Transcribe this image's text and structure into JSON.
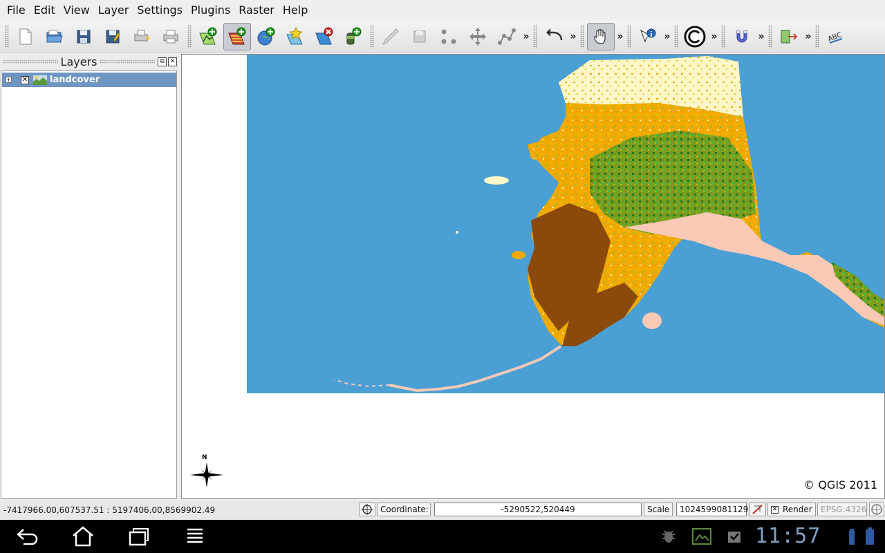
{
  "menu": [
    {
      "label": "File",
      "name": "menu-file"
    },
    {
      "label": "Edit",
      "name": "menu-edit"
    },
    {
      "label": "View",
      "name": "menu-view"
    },
    {
      "label": "Layer",
      "name": "menu-layer"
    },
    {
      "label": "Settings",
      "name": "menu-settings"
    },
    {
      "label": "Plugins",
      "name": "menu-plugins"
    },
    {
      "label": "Raster",
      "name": "menu-raster"
    },
    {
      "label": "Help",
      "name": "menu-help"
    }
  ],
  "toolbar": {
    "more_label": "»",
    "icons": [
      "new-project-icon",
      "open-project-icon",
      "save-project-icon",
      "save-as-icon",
      "print-composer-icon",
      "print-icon",
      "add-vector-layer-icon",
      "add-raster-layer-icon",
      "add-wms-layer-icon",
      "new-shapefile-icon",
      "remove-layer-icon",
      "add-postgis-icon",
      "toggle-editing-icon",
      "save-edits-icon",
      "capture-point-icon",
      "move-feature-icon",
      "node-tool-icon",
      "undo-icon",
      "pan-icon",
      "identify-icon",
      "copyright-label-icon",
      "magnet-icon",
      "georeferencer-icon",
      "label-icon"
    ]
  },
  "layers_panel": {
    "title": "Layers",
    "float_label": "⧉",
    "close_label": "✕",
    "layers": [
      {
        "name": "landcover",
        "expander": "+",
        "visible_mark": "✕"
      }
    ]
  },
  "map": {
    "copyright": "© QGIS 2011",
    "north_label": "N",
    "ocean_color": "#4a9fd4",
    "land_colors": [
      "#f2a900",
      "#8b4a0c",
      "#e0b000",
      "#1f7a1f",
      "#3ec13e",
      "#f9c9b6",
      "#fff7c8",
      "#a8b830"
    ]
  },
  "status": {
    "extent": "-7417966.00,607537.51 : 5197406.00,8569902.49",
    "coordinate_label": "Coordinate:",
    "coordinate_value": "-5290522,520449",
    "scale_label": "Scale",
    "scale_value": "1024599081129",
    "render_label": "Render",
    "render_mark": "✕",
    "epsg": "EPSG:4326"
  },
  "system": {
    "clock": "11:57"
  }
}
